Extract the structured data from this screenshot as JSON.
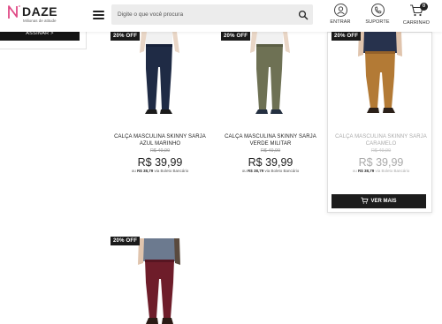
{
  "header": {
    "logo_text": "DAZE",
    "logo_tagline": "Milionas de atitude",
    "search_placeholder": "Digite o que você procura",
    "actions": {
      "entrar": "ENTRAR",
      "suporte": "SUPORTE",
      "carrinho": "CARRINHO",
      "cart_count": "0"
    }
  },
  "sidebar": {
    "subscribe_label": "ASSINAR >"
  },
  "products": [
    {
      "badge": "20% OFF",
      "name": "CALÇA MASCULINA SKINNY SARJA AZUL MARINHO",
      "old_price": "R$ 49,99",
      "price": "R$ 39,99",
      "boleto_prefix": "ou",
      "boleto_price": "R$ 38,79",
      "boleto_suffix": "via Boleto Bancário",
      "pants_color": "#1f2b45"
    },
    {
      "badge": "20% OFF",
      "name": "CALÇA MASCULINA SKINNY SARJA VERDE MILITAR",
      "old_price": "R$ 49,99",
      "price": "R$ 39,99",
      "boleto_prefix": "ou",
      "boleto_price": "R$ 38,79",
      "boleto_suffix": "via Boleto Bancário",
      "pants_color": "#6e7154"
    },
    {
      "badge": "20% OFF",
      "name": "CALÇA MASCULINA SKINNY SARJA CARAMELO",
      "old_price": "R$ 49,99",
      "price": "R$ 39,99",
      "boleto_prefix": "ou",
      "boleto_price": "R$ 38,79",
      "boleto_suffix": "via Boleto Bancário",
      "pants_color": "#b37a35",
      "cta": "VER MAIS"
    },
    {
      "badge": "20% OFF",
      "pants_color": "#6e1d2a"
    }
  ],
  "colors": {
    "accent": "#1a1a1a",
    "logo_n": "#e04a86"
  }
}
